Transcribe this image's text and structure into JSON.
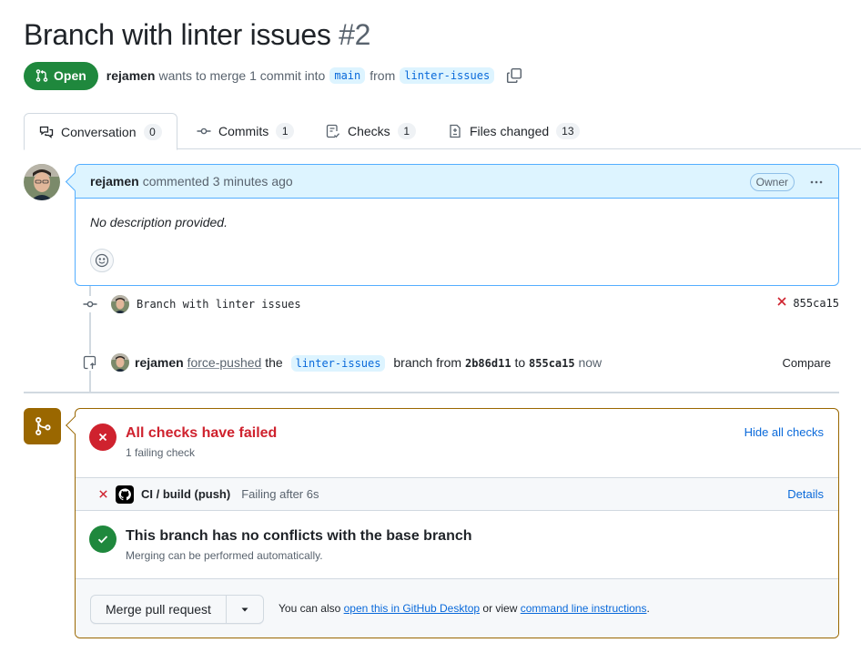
{
  "pr": {
    "title": "Branch with linter issues",
    "number": "#2",
    "state_label": "Open",
    "author": "rejamen",
    "merge_text": "wants to merge 1 commit into",
    "base_branch": "main",
    "from_text": "from",
    "head_branch": "linter-issues"
  },
  "tabs": [
    {
      "label": "Conversation",
      "count": "0",
      "icon": "comment-discussion-icon"
    },
    {
      "label": "Commits",
      "count": "1",
      "icon": "git-commit-icon"
    },
    {
      "label": "Checks",
      "count": "1",
      "icon": "checklist-icon"
    },
    {
      "label": "Files changed",
      "count": "13",
      "icon": "file-diff-icon"
    }
  ],
  "comment": {
    "author": "rejamen",
    "action": "commented 3 minutes ago",
    "badge": "Owner",
    "body": "No description provided."
  },
  "timeline": {
    "commit_message": "Branch with linter issues",
    "commit_sha": "855ca15",
    "push_author": "rejamen",
    "push_action": "force-pushed",
    "push_the": "the",
    "push_branch": "linter-issues",
    "push_branch_from": "branch from",
    "push_from_sha": "2b86d11",
    "push_to": "to",
    "push_to_sha": "855ca15",
    "push_when": "now",
    "compare_label": "Compare"
  },
  "checks": {
    "title": "All checks have failed",
    "subtitle": "1 failing check",
    "hide_label": "Hide all checks",
    "items": [
      {
        "name": "CI / build (push)",
        "status": "Failing after 6s",
        "details_label": "Details"
      }
    ]
  },
  "mergeability": {
    "title": "This branch has no conflicts with the base branch",
    "subtitle": "Merging can be performed automatically."
  },
  "merge": {
    "button_label": "Merge pull request",
    "hint_prefix": "You can also",
    "desktop_link": "open this in GitHub Desktop",
    "hint_middle": "or view",
    "cli_link": "command line instructions",
    "hint_suffix": "."
  },
  "colors": {
    "open_green": "#1f883d",
    "fail_red": "#cf222e",
    "link_blue": "#0969da",
    "warn_brown": "#9a6700",
    "comment_header_bg": "#ddf4ff"
  }
}
